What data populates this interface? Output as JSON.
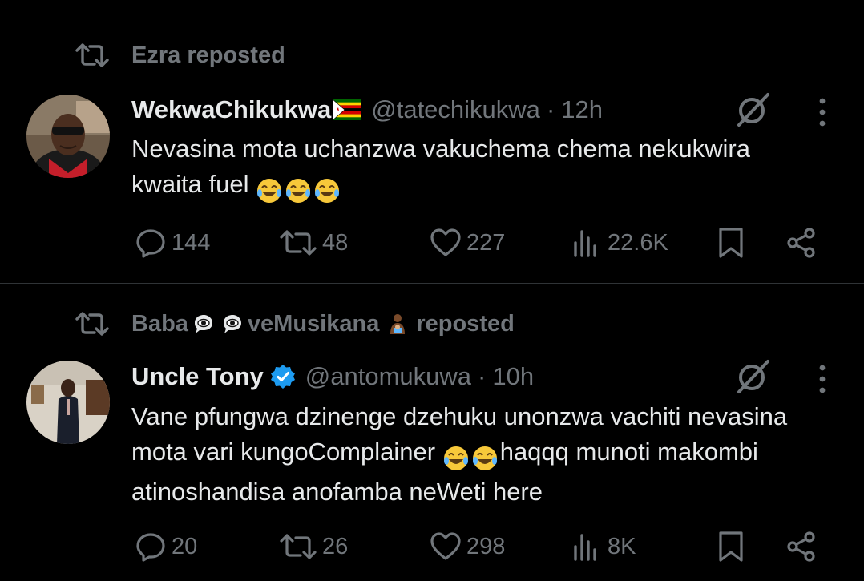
{
  "tweets": [
    {
      "repost_by": "Ezra reposted",
      "display_name": "WekwaChikukwa",
      "handle": "@tatechikukwa",
      "separator": "·",
      "time": "12h",
      "text_lines": [
        "Nevasina mota uchanzwa vakuchema chema nekukwira",
        "kwaita fuel"
      ],
      "actions": {
        "replies": "144",
        "reposts": "48",
        "likes": "227",
        "views": "22.6K"
      }
    },
    {
      "repost_by_parts": [
        "Baba",
        "veMusikana",
        "reposted"
      ],
      "display_name": "Uncle Tony",
      "handle": "@antomukuwa",
      "separator": "·",
      "time": "10h",
      "text_lines": [
        "Vane pfungwa dzinenge dzehuku unonzwa vachiti nevasina",
        "mota vari kungoComplainer",
        "haqqq munoti makombi",
        "atinoshandisa anofamba neWeti here"
      ],
      "actions": {
        "replies": "20",
        "reposts": "26",
        "likes": "298",
        "views": "8K"
      }
    }
  ],
  "icons": {
    "repost": "repost-icon",
    "reply": "reply-icon",
    "like": "heart-icon",
    "views": "views-icon",
    "bookmark": "bookmark-icon",
    "share": "share-icon",
    "grok": "grok-icon",
    "more": "more-icon"
  },
  "colors": {
    "background": "#000000",
    "text": "#e7e9ea",
    "secondary": "#71767b",
    "divider": "#2f3336",
    "verified": "#1d9bf0"
  }
}
